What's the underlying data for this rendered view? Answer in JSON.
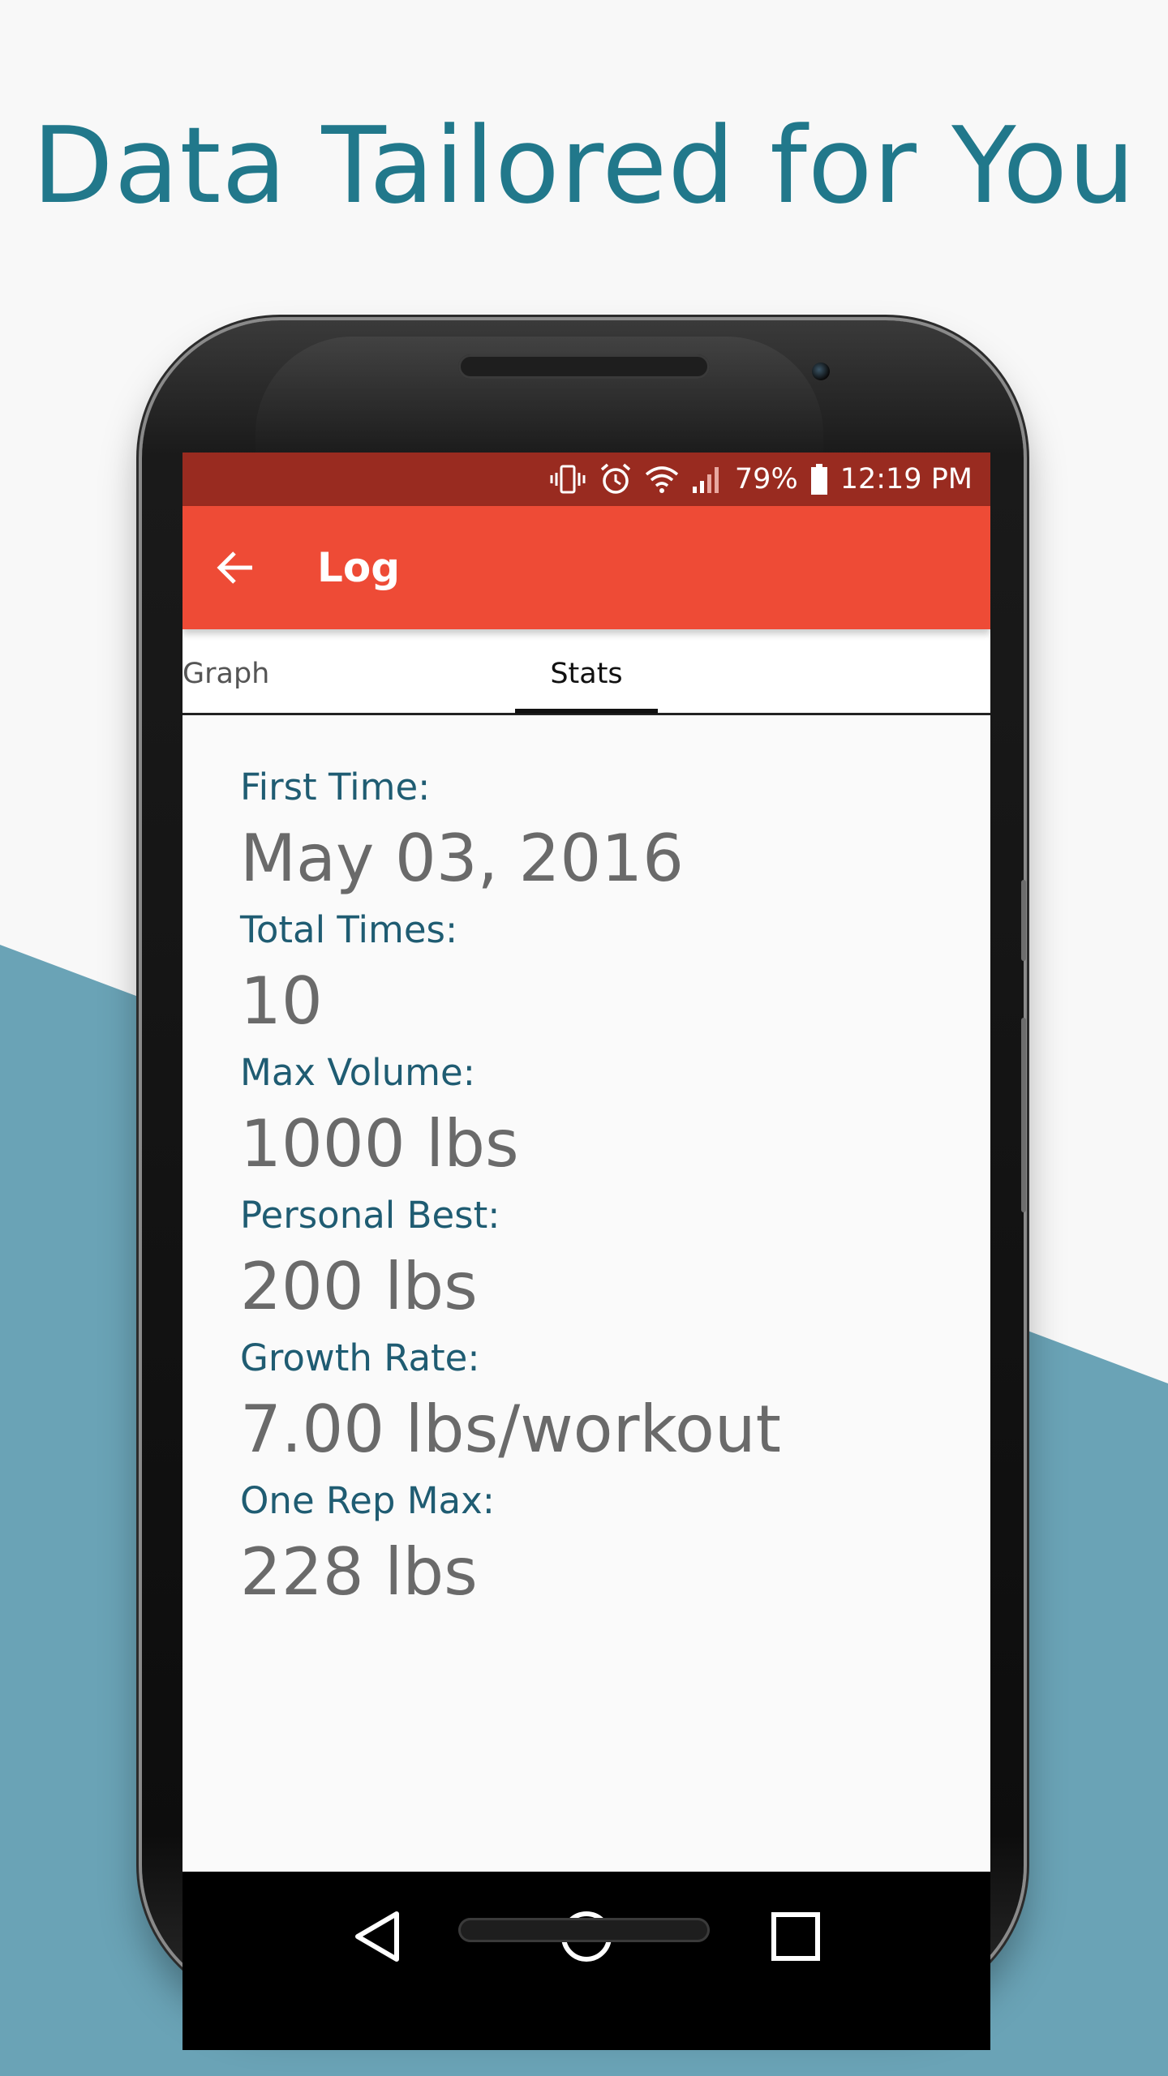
{
  "headline": "Data Tailored for You",
  "status_bar": {
    "battery": "79%",
    "time": "12:19 PM",
    "icons": [
      "vibrate-icon",
      "alarm-icon",
      "wifi-icon",
      "signal-icon",
      "battery-icon"
    ]
  },
  "app_bar": {
    "title": "Log",
    "back_icon": "arrow-back-icon"
  },
  "tabs": [
    {
      "label": "Graph",
      "selected": false
    },
    {
      "label": "Stats",
      "selected": true
    }
  ],
  "stats": [
    {
      "label": "First Time:",
      "value": "May 03, 2016"
    },
    {
      "label": "Total Times:",
      "value": "10"
    },
    {
      "label": "Max Volume:",
      "value": "1000 lbs"
    },
    {
      "label": "Personal Best:",
      "value": "200 lbs"
    },
    {
      "label": "Growth Rate:",
      "value": "7.00 lbs/workout"
    },
    {
      "label": "One Rep Max:",
      "value": "228 lbs"
    }
  ],
  "nav_bar": {
    "icons": [
      "back-triangle-icon",
      "home-circle-icon",
      "recents-square-icon"
    ]
  },
  "colors": {
    "headline": "#21788b",
    "status_bar": "#992b20",
    "app_bar": "#ee4b36",
    "stat_label": "#1f5c72",
    "stat_value": "#6a6a6a",
    "background_wedge": "#6aa3b6"
  }
}
